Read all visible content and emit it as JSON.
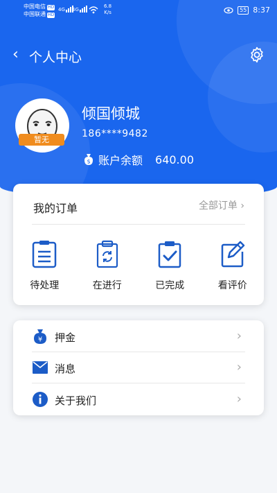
{
  "status_bar": {
    "carrier1": "中国电信",
    "carrier2": "中国联通",
    "hd": "HD",
    "net1": "4G",
    "net2": "4G",
    "speed_value": "6.8",
    "speed_unit": "K/s",
    "battery": "55",
    "time": "8:37"
  },
  "nav": {
    "back_glyph": "‹",
    "title": "个人中心"
  },
  "profile": {
    "avatar_tag": "暂无",
    "username": "倾国倾城",
    "phone": "186****9482",
    "balance_label": "账户余额",
    "balance_value": "640.00"
  },
  "orders": {
    "title": "我的订单",
    "all_label": "全部订单",
    "items": [
      {
        "label": "待处理",
        "icon": "pending-clipboard-icon"
      },
      {
        "label": "在进行",
        "icon": "in-progress-refresh-icon"
      },
      {
        "label": "已完成",
        "icon": "completed-check-icon"
      },
      {
        "label": "看评价",
        "icon": "review-edit-icon"
      }
    ]
  },
  "menu": {
    "items": [
      {
        "label": "押金",
        "icon": "deposit-bag-icon"
      },
      {
        "label": "消息",
        "icon": "message-envelope-icon"
      },
      {
        "label": "关于我们",
        "icon": "info-icon"
      }
    ]
  },
  "colors": {
    "primary": "#1a66ee",
    "icon_blue": "#1c5cc7",
    "tag_orange": "#f08c1e"
  }
}
